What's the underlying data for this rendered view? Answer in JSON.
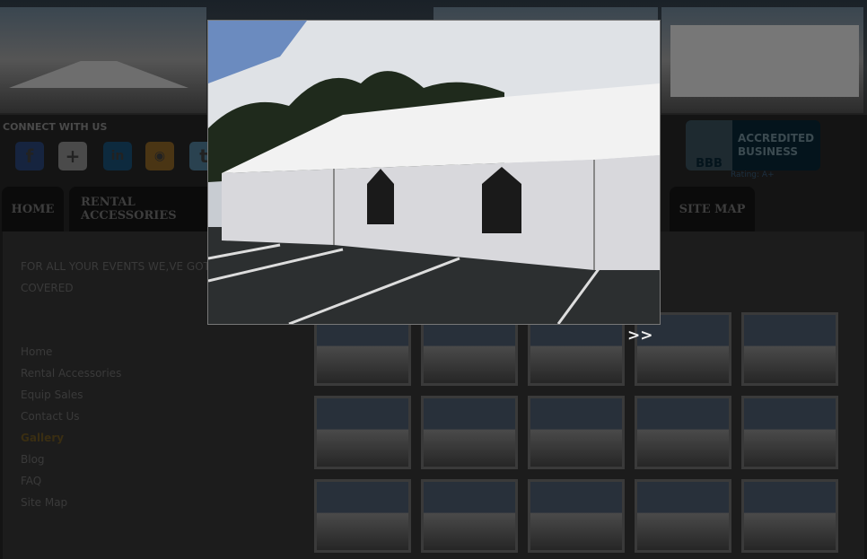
{
  "header": {
    "connect_label": "CONNECT WITH US"
  },
  "social": [
    {
      "name": "facebook",
      "glyph": "f",
      "color": "#16243f"
    },
    {
      "name": "google-plus",
      "glyph": "+",
      "color": "#4a4a4a"
    },
    {
      "name": "linkedin",
      "glyph": "in",
      "color": "#0d2a3e"
    },
    {
      "name": "rss",
      "glyph": "◉",
      "color": "#4a3514"
    },
    {
      "name": "twitter",
      "glyph": "t",
      "color": "#2a4250"
    }
  ],
  "nav": {
    "tabs": [
      "HOME",
      "RENTAL ACCESSORIES",
      "SITE MAP"
    ]
  },
  "bbb": {
    "logo": "BBB",
    "line1": "ACCREDITED",
    "line2": "BUSINESS",
    "rating": "Rating: A+"
  },
  "tagline": "FOR ALL YOUR EVENTS WE,VE GOT COVERED",
  "sidebar": {
    "items": [
      "Home",
      "Rental Accessories",
      "Equip Sales",
      "Contact Us",
      "Gallery",
      "Blog",
      "FAQ",
      "Site Map"
    ],
    "active": "Gallery"
  },
  "lightbox": {
    "next_label": ">>"
  }
}
